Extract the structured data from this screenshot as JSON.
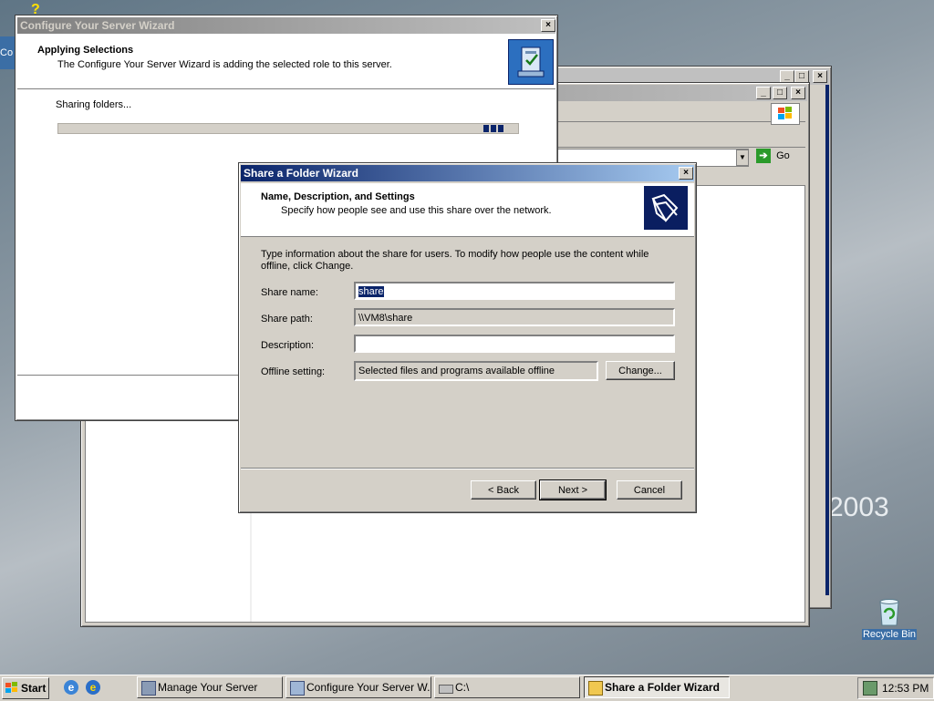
{
  "desktop": {
    "watermark": "2003",
    "recycle_bin_label": "Recycle Bin",
    "desktop_fragment": "Co"
  },
  "configure_wizard": {
    "title": "Configure Your Server Wizard",
    "heading": "Applying Selections",
    "subheading": "The Configure Your Server Wizard is adding the selected role to this server.",
    "status": "Sharing folders...",
    "progress_marquee": "indeterminate"
  },
  "explorer_window": {
    "go_label": "Go"
  },
  "share_wizard": {
    "title": "Share a Folder Wizard",
    "heading": "Name, Description, and Settings",
    "subheading": "Specify how people see and use this share over the network.",
    "intro": "Type information about the share for users. To modify how people use the content while offline, click Change.",
    "share_name_label": "Share name:",
    "share_name_value": "share",
    "share_path_label": "Share path:",
    "share_path_value": "\\\\VM8\\share",
    "description_label": "Description:",
    "description_value": "",
    "offline_label": "Offline setting:",
    "offline_value": "Selected files and programs available offline",
    "change_button": "Change...",
    "back_button": "< Back",
    "next_button": "Next >",
    "cancel_button": "Cancel"
  },
  "taskbar": {
    "start_label": "Start",
    "items": [
      {
        "label": "Manage Your Server"
      },
      {
        "label": "Configure Your Server W..."
      },
      {
        "label": "C:\\"
      },
      {
        "label": "Share a Folder Wizard"
      }
    ],
    "clock": "12:53 PM"
  }
}
